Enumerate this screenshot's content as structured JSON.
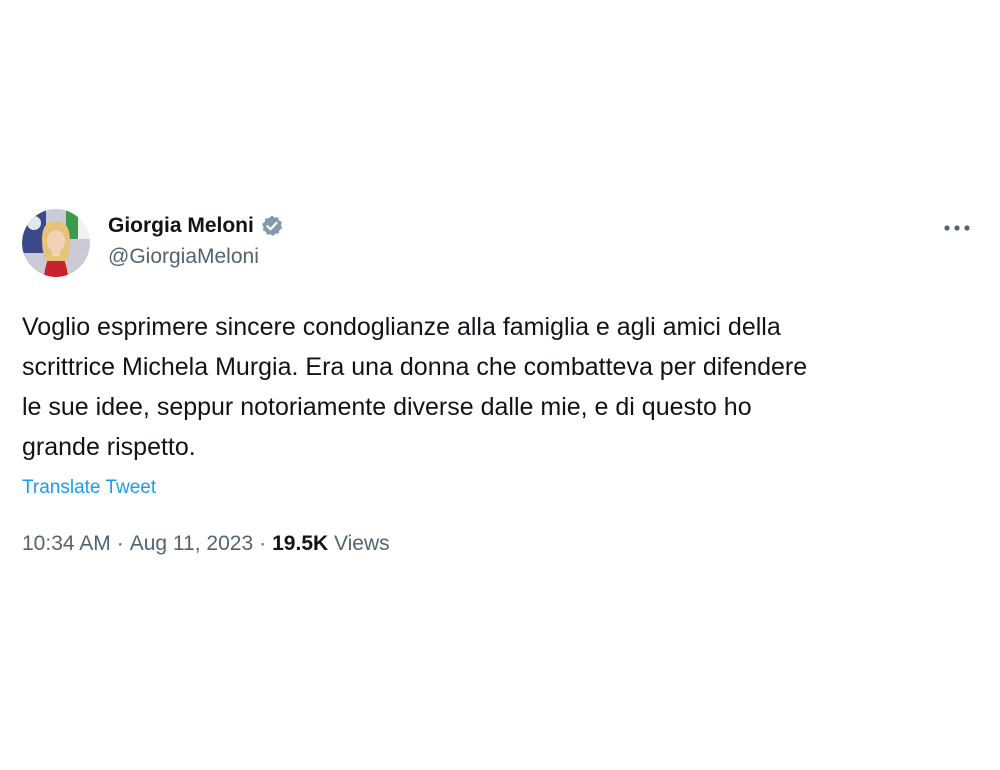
{
  "author": {
    "display_name": "Giorgia Meloni",
    "handle": "@GiorgiaMeloni",
    "verified": true,
    "avatar_icon": "profile-photo"
  },
  "tweet": {
    "text_lines": [
      "Voglio esprimere sincere condoglianze alla famiglia e agli amici della",
      "scrittrice Michela Murgia. Era una donna che combatteva per difendere",
      "le sue idee, seppur notoriamente diverse dalle mie, e di questo ho",
      "grande rispetto."
    ],
    "translate_label": "Translate Tweet"
  },
  "meta": {
    "time": "10:34 AM",
    "separator": "·",
    "date": "Aug 11, 2023",
    "views_count": "19.5K",
    "views_label": "Views"
  },
  "icons": {
    "verified": "verified-badge-icon",
    "more": "more-options-icon"
  },
  "colors": {
    "text_primary": "#0f1419",
    "text_secondary": "#536471",
    "link": "#1d9bf0",
    "verified_badge": "#829aab"
  }
}
